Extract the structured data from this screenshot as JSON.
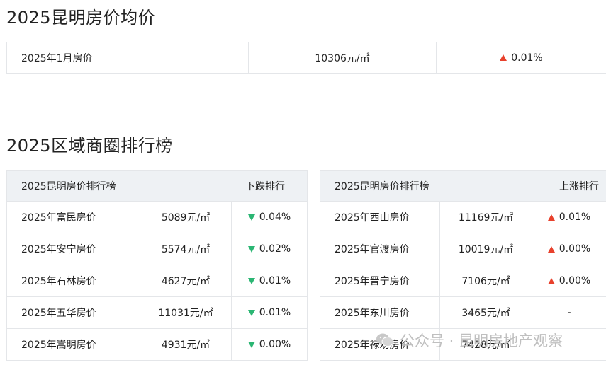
{
  "section1": {
    "title": "2025昆明房价均价",
    "summary": {
      "label": "2025年1月房价",
      "price": "10306元/㎡",
      "change": "0.01%",
      "direction": "up"
    }
  },
  "section2": {
    "title": "2025区域商圈排行榜",
    "left_table": {
      "header_title": "2025昆明房价排行榜",
      "header_sort": "下跌排行",
      "rows": [
        {
          "name": "2025年富民房价",
          "price": "5089元/㎡",
          "change": "0.04%",
          "direction": "down"
        },
        {
          "name": "2025年安宁房价",
          "price": "5574元/㎡",
          "change": "0.02%",
          "direction": "down"
        },
        {
          "name": "2025年石林房价",
          "price": "4627元/㎡",
          "change": "0.01%",
          "direction": "down"
        },
        {
          "name": "2025年五华房价",
          "price": "11031元/㎡",
          "change": "0.01%",
          "direction": "down"
        },
        {
          "name": "2025年嵩明房价",
          "price": "4931元/㎡",
          "change": "0.00%",
          "direction": "down"
        }
      ]
    },
    "right_table": {
      "header_title": "2025昆明房价排行榜",
      "header_sort": "上涨排行",
      "rows": [
        {
          "name": "2025年西山房价",
          "price": "11169元/㎡",
          "change": "0.01%",
          "direction": "up"
        },
        {
          "name": "2025年官渡房价",
          "price": "10019元/㎡",
          "change": "0.00%",
          "direction": "up"
        },
        {
          "name": "2025年晋宁房价",
          "price": "7106元/㎡",
          "change": "0.00%",
          "direction": "up"
        },
        {
          "name": "2025年东川房价",
          "price": "3465元/㎡",
          "change": "-",
          "direction": "none"
        },
        {
          "name": "2025年禄劝房价",
          "price": "7428元/㎡",
          "change": "",
          "direction": "none"
        }
      ]
    }
  },
  "watermark": {
    "text": "公众号 · 昆明房地产观察",
    "icon": "wechat-icon"
  },
  "colors": {
    "up": "#e8412c",
    "down": "#2bb673",
    "header_bg": "#eef1f4",
    "border": "#e4e6e9"
  }
}
